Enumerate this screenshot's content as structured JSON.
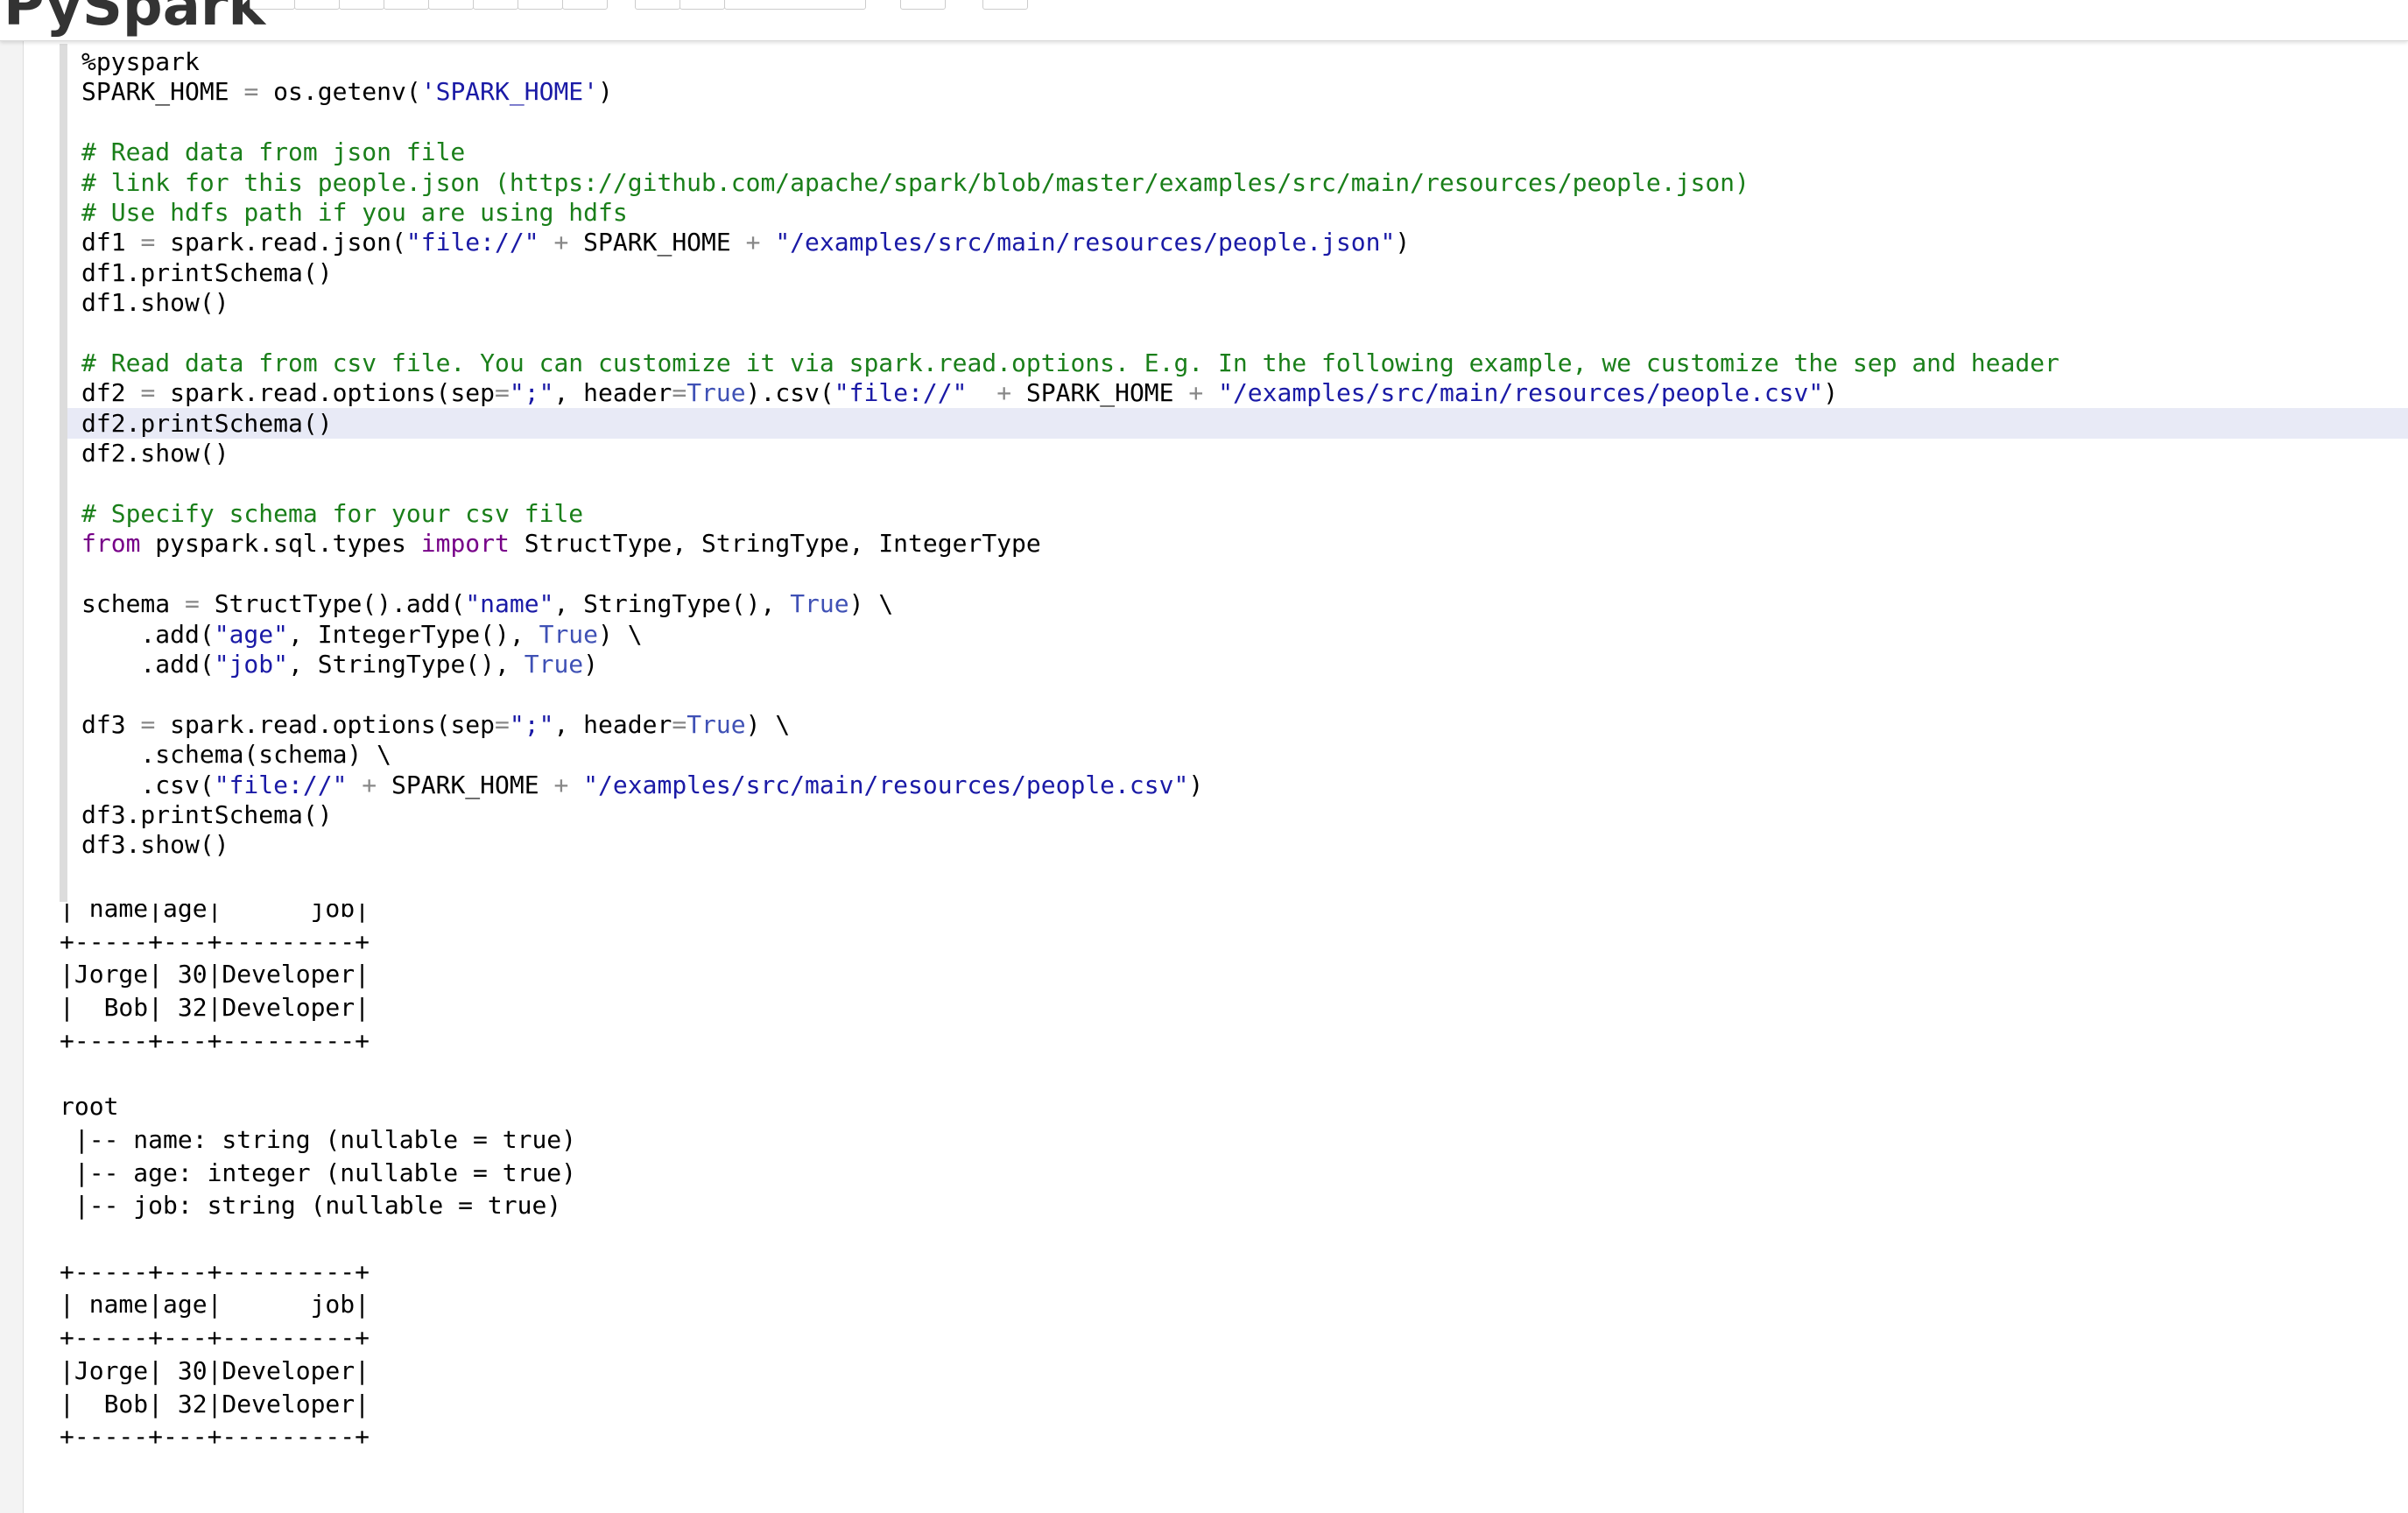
{
  "header": {
    "title": "PySpark"
  },
  "editor": {
    "lines": [
      {
        "text": "%pyspark",
        "active": false
      },
      {
        "text": "SPARK_HOME = os.getenv('SPARK_HOME')",
        "active": false
      },
      {
        "text": "",
        "active": false
      },
      {
        "text": "# Read data from json file",
        "active": false
      },
      {
        "text": "# link for this people.json (https://github.com/apache/spark/blob/master/examples/src/main/resources/people.json)",
        "active": false
      },
      {
        "text": "# Use hdfs path if you are using hdfs",
        "active": false
      },
      {
        "text": "df1 = spark.read.json(\"file://\" + SPARK_HOME + \"/examples/src/main/resources/people.json\")",
        "active": false
      },
      {
        "text": "df1.printSchema()",
        "active": false
      },
      {
        "text": "df1.show()",
        "active": false
      },
      {
        "text": "",
        "active": false
      },
      {
        "text": "# Read data from csv file. You can customize it via spark.read.options. E.g. In the following example, we customize the sep and header",
        "active": false
      },
      {
        "text": "df2 = spark.read.options(sep=\";\", header=True).csv(\"file://\"  + SPARK_HOME + \"/examples/src/main/resources/people.csv\")",
        "active": false
      },
      {
        "text": "df2.printSchema()",
        "active": true
      },
      {
        "text": "df2.show()",
        "active": false
      },
      {
        "text": "",
        "active": false
      },
      {
        "text": "# Specify schema for your csv file",
        "active": false
      },
      {
        "text": "from pyspark.sql.types import StructType, StringType, IntegerType",
        "active": false
      },
      {
        "text": "",
        "active": false
      },
      {
        "text": "schema = StructType().add(\"name\", StringType(), True) \\",
        "active": false
      },
      {
        "text": "    .add(\"age\", IntegerType(), True) \\",
        "active": false
      },
      {
        "text": "    .add(\"job\", StringType(), True)",
        "active": false
      },
      {
        "text": "",
        "active": false
      },
      {
        "text": "df3 = spark.read.options(sep=\";\", header=True) \\",
        "active": false
      },
      {
        "text": "    .schema(schema) \\",
        "active": false
      },
      {
        "text": "    .csv(\"file://\" + SPARK_HOME + \"/examples/src/main/resources/people.csv\")",
        "active": false
      },
      {
        "text": "df3.printSchema()",
        "active": false
      },
      {
        "text": "df3.show()",
        "active": false
      }
    ]
  },
  "output": {
    "lines": [
      "| name|age|      job|",
      "+-----+---+---------+",
      "|Jorge| 30|Developer|",
      "|  Bob| 32|Developer|",
      "+-----+---+---------+",
      "",
      "root",
      " |-- name: string (nullable = true)",
      " |-- age: integer (nullable = true)",
      " |-- job: string (nullable = true)",
      "",
      "+-----+---+---------+",
      "| name|age|      job|",
      "+-----+---+---------+",
      "|Jorge| 30|Developer|",
      "|  Bob| 32|Developer|",
      "+-----+---+---------+"
    ]
  },
  "colors": {
    "comment": "#1a7f1a",
    "string": "#1a1aa6",
    "keyword": "#770088",
    "builtin": "#3f51b5",
    "operator": "#888888",
    "active_line": "#e8eaf6"
  }
}
